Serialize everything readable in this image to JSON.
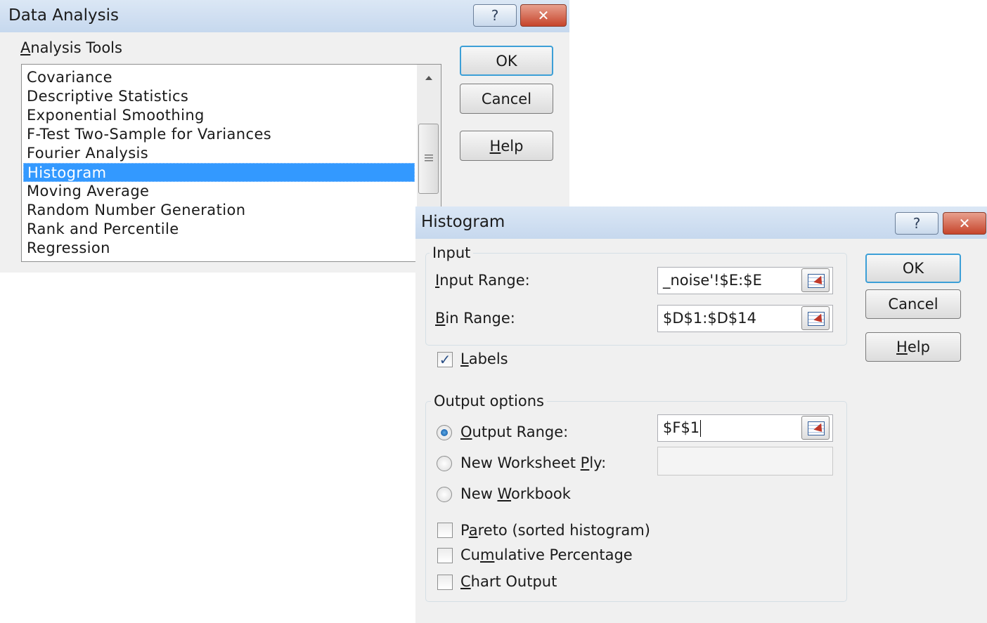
{
  "data_analysis": {
    "title": "Data Analysis",
    "help_glyph": "?",
    "close_glyph": "✕",
    "tools_label_hotkey": "A",
    "tools_label_rest": "nalysis Tools",
    "tools": [
      "Covariance",
      "Descriptive Statistics",
      "Exponential Smoothing",
      "F-Test Two-Sample for Variances",
      "Fourier Analysis",
      "Histogram",
      "Moving Average",
      "Random Number Generation",
      "Rank and Percentile",
      "Regression"
    ],
    "selected_tool": "Histogram",
    "ok_label": "OK",
    "cancel_label": "Cancel",
    "help_hotkey": "H",
    "help_rest": "elp"
  },
  "histogram": {
    "title": "Histogram",
    "help_glyph": "?",
    "close_glyph": "✕",
    "input_group": "Input",
    "input_range_hotkey": "I",
    "input_range_rest": "nput Range:",
    "input_range_value": "_noise'!$E:$E",
    "bin_range_hotkey": "B",
    "bin_range_rest": "in Range:",
    "bin_range_value": "$D$1:$D$14",
    "labels_hotkey": "L",
    "labels_rest": "abels",
    "labels_checked": true,
    "output_group": "Output options",
    "output_range_hotkey": "O",
    "output_range_rest": "utput Range:",
    "output_range_value": "$F$1",
    "new_sheet_pre": "New Worksheet ",
    "new_sheet_hotkey": "P",
    "new_sheet_rest": "ly:",
    "new_workbook_pre": "New ",
    "new_workbook_hotkey": "W",
    "new_workbook_rest": "orkbook",
    "selected_output": "Output Range",
    "pareto_pre": "P",
    "pareto_hotkey": "a",
    "pareto_rest": "reto (sorted histogram)",
    "cumulative_pre": "Cu",
    "cumulative_hotkey": "m",
    "cumulative_rest": "ulative Percentage",
    "chart_hotkey": "C",
    "chart_rest": "hart Output",
    "ok_label": "OK",
    "cancel_label": "Cancel",
    "help_hotkey": "H",
    "help_rest": "elp"
  }
}
